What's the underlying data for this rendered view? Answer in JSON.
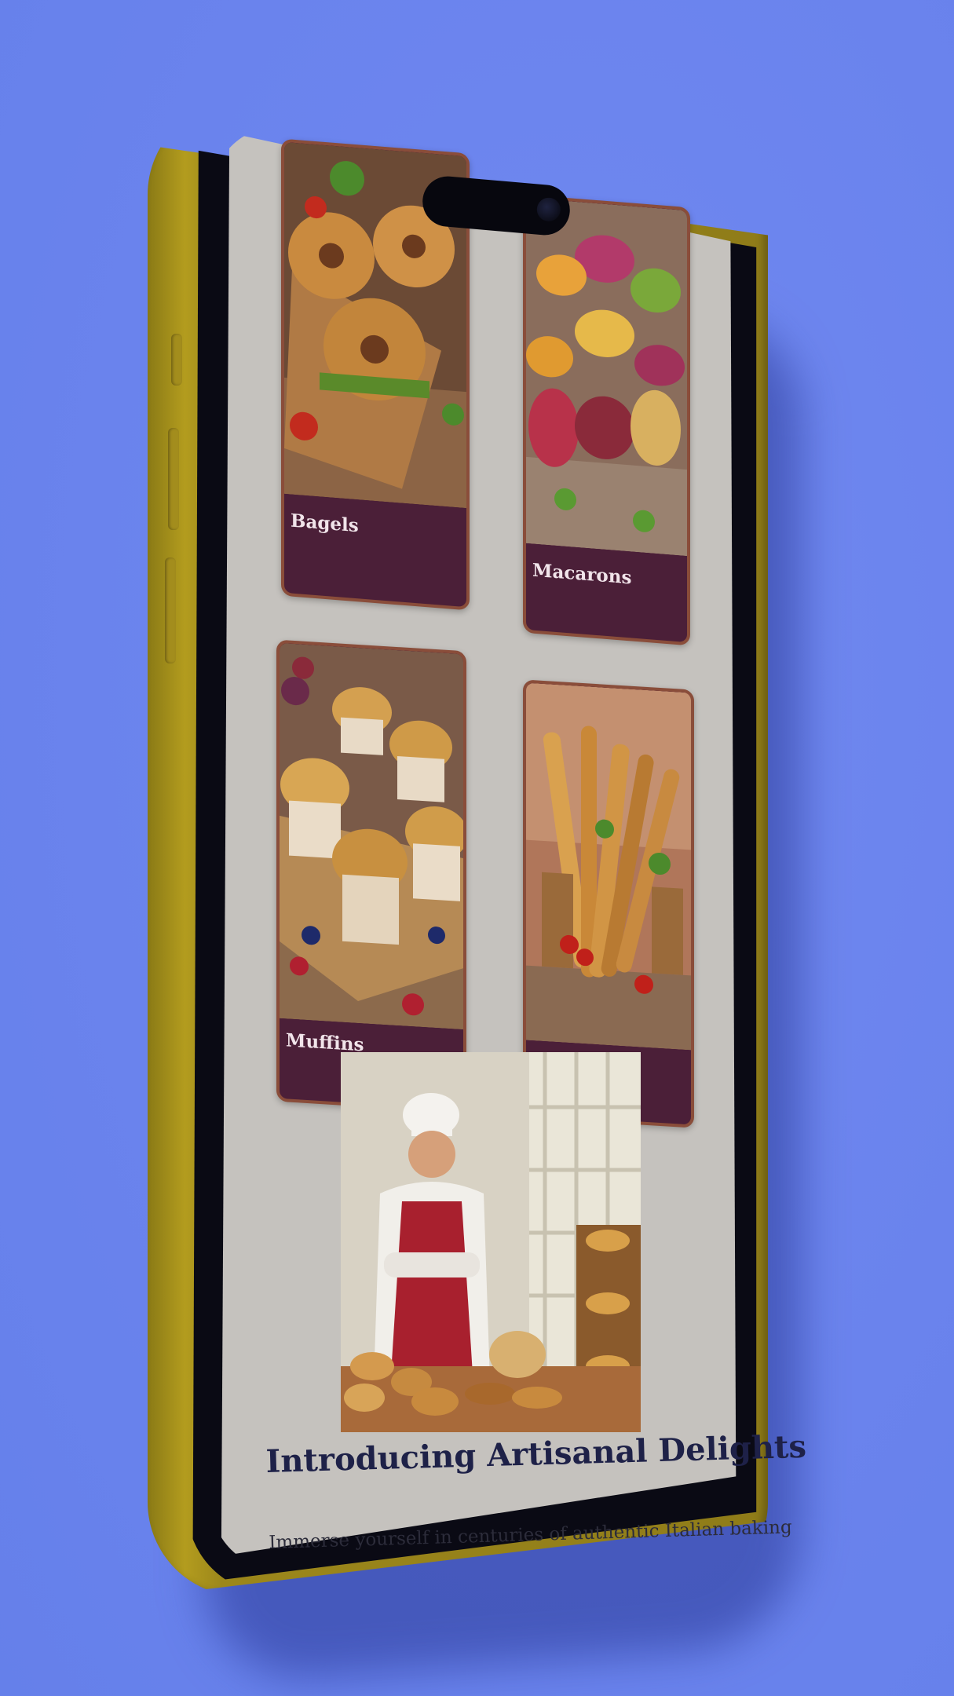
{
  "products": [
    {
      "name": "Bagels",
      "image": "bagels-photo"
    },
    {
      "name": "Macarons",
      "image": "macarons-photo"
    },
    {
      "name": "Muffins",
      "image": "muffins-photo"
    },
    {
      "name": "",
      "image": "baguettes-photo"
    }
  ],
  "about": {
    "image": "chef-bakery-photo",
    "headline": "Introducing Artisanal Delights",
    "body": "Immerse yourself in centuries of authentic Italian baking"
  },
  "colors": {
    "background": "#6b84ee",
    "phone_frame": "#9c871b",
    "screen_bg": "#c5c2be",
    "card_footer": "#4b1f38",
    "card_border": "#8a4d3a",
    "headline": "#1e2148"
  }
}
